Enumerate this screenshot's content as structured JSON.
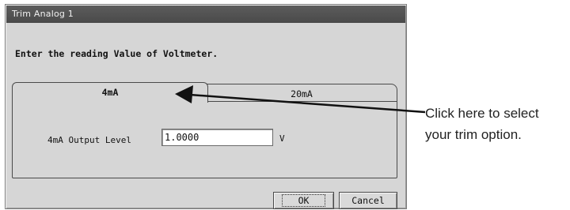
{
  "dialog": {
    "title": "Trim Analog 1",
    "prompt": "Enter the reading Value of Voltmeter.",
    "tabs": [
      {
        "label": "4mA",
        "selected": true
      },
      {
        "label": "20mA",
        "selected": false
      }
    ],
    "field": {
      "label": "4mA Output Level",
      "value": "1.0000",
      "unit": "V"
    },
    "buttons": {
      "ok": "OK",
      "cancel": "Cancel"
    }
  },
  "annotation": {
    "line1": "Click here to select",
    "line2": "your trim option."
  },
  "colors": {
    "titlebar": "#4f4f4f",
    "dialog_bg": "#d6d6d6"
  }
}
